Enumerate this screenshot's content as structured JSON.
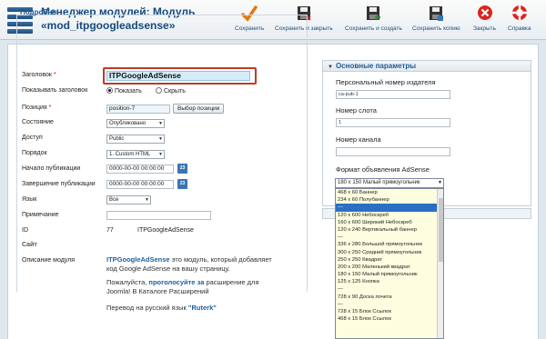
{
  "header": {
    "title_line1": "Менеджер модулей: Модуль",
    "title_line2": "«mod_itpgoogleadsense»",
    "toolbar": [
      {
        "label": "Сохранить",
        "icon": "checkmark-icon"
      },
      {
        "label": "Сохранить и закрыть",
        "icon": "save-close-icon"
      },
      {
        "label": "Сохранить и создать",
        "icon": "save-new-icon"
      },
      {
        "label": "Сохранить копию",
        "icon": "save-copy-icon"
      },
      {
        "label": "Закрыть",
        "icon": "close-icon"
      },
      {
        "label": "Справка",
        "icon": "help-icon"
      }
    ]
  },
  "details": {
    "legend": "Подробно",
    "title_label": "Заголовок",
    "title_value": "ITPGoogleAdSense",
    "show_title_label": "Показывать заголовок",
    "show_option": "Показать",
    "hide_option": "Скрыть",
    "position_label": "Позиция",
    "position_value": "position-7",
    "position_button": "Выбор позиции",
    "state_label": "Состояние",
    "state_value": "Опубликовано",
    "access_label": "Доступ",
    "access_value": "Public",
    "order_label": "Порядок",
    "order_value": "1. Custom HTML",
    "publish_up_label": "Начало публикации",
    "publish_up_value": "0000-00-00 00:00:00",
    "publish_down_label": "Завершение публикации",
    "publish_down_value": "0000-00-00 00:00:00",
    "calendar_icon_text": "23",
    "language_label": "Язык",
    "language_value": "Все",
    "note_label": "Примечание",
    "note_value": "",
    "id_label": "ID",
    "id_value": "77",
    "id_name": "ITPGoogleAdSense",
    "site_label": "Сайт",
    "desc_label": "Описание модуля",
    "desc_name": "ITPGoogleAdSense",
    "desc_line1_rest": " это модуль, который добавляет",
    "desc_line2": "код Google AdSense на вашу страницу.",
    "desc_line3_pre": "Пожалуйста, ",
    "desc_line3_link": "проголосуйте за",
    "desc_line3_post": " расширение для",
    "desc_line4": "Joomla! В Каталоге Расширений",
    "desc_line5_pre": "Перевод на русский язык ",
    "desc_line5_name": "\"Ruterk\""
  },
  "params": {
    "header": "Основные параметры",
    "publisher_label": "Персональный номер издателя",
    "publisher_value": "ca-pub-1",
    "slot_label": "Номер слота",
    "slot_value": "1",
    "channel_label": "Номер канала",
    "channel_value": "",
    "format_label": "Формат объявления AdSense",
    "format_value": "180 x 150 Малый прямоугольник",
    "format_options": [
      "468 x 60 Баннер",
      "234 x 60 Полубаннер",
      "",
      "120 x 600 Небоскреб",
      "160 x 600 Широкий Небоскреб",
      "120 x 240 Вертикальный баннер",
      "",
      "336 x 280 Большой прямоугольник",
      "300 x 250 Средний прямоугольник",
      "250 x 250 Квадрат",
      "200 x 200 Маленький квадрат",
      "180 x 150 Малый прямоугольник",
      "125 x 125 Кнопка",
      "",
      "728 x 90 Доска почета",
      "",
      "728 x 15 Блок Ссылок",
      "468 x 15 Блок Ссылок"
    ],
    "format_selected_index": 2
  }
}
